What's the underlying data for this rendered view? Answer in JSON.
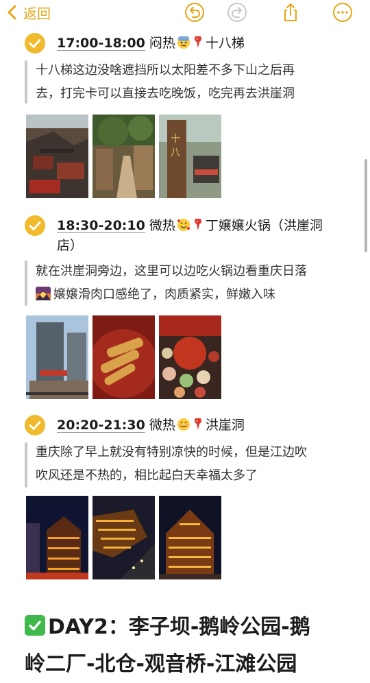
{
  "nav": {
    "back_label": "返回"
  },
  "colors": {
    "accent": "#e8a515",
    "check_bg": "#f0ba2c",
    "quote_bar": "#c7c7cc",
    "green_check": "#3fb94b"
  },
  "icons": [
    "chevron-left-icon",
    "undo-icon",
    "redo-icon",
    "share-icon",
    "more-icon",
    "checkmark-icon",
    "pin-icon"
  ],
  "sections": [
    {
      "time": "17:00-18:00",
      "weather": "闷热",
      "emoji": "anxious-sweat-face",
      "place": "十八梯",
      "lines": [
        "十八梯这边没啥遮挡所以太阳差不多下山之后再",
        "去，打完卡可以直接去吃晚饭，吃完再去洪崖洞"
      ]
    },
    {
      "time": "18:30-20:10",
      "weather": "微热",
      "emoji": "smiling-face-with-hearts",
      "place": "丁嬢嬢火锅（洪崖洞",
      "place_line2": "店）",
      "lines": [
        "就在洪崖洞旁边，这里可以边吃火锅边看重庆日落",
        "嬢嬢滑肉口感绝了，肉质紧实，鲜嫩入味"
      ]
    },
    {
      "time": "20:20-21:30",
      "weather": "微热",
      "emoji": "smiling-face",
      "place": "洪崖洞",
      "lines": [
        "重庆除了早上就没有特别凉快的时候，但是江边吹",
        "吹风还是不热的，相比起白天幸福太多了"
      ]
    }
  ],
  "day2": {
    "line1": "DAY2：李子坝-鹅岭公园-鹅",
    "line2": "岭二厂-北仓-观音桥-江滩公园"
  }
}
